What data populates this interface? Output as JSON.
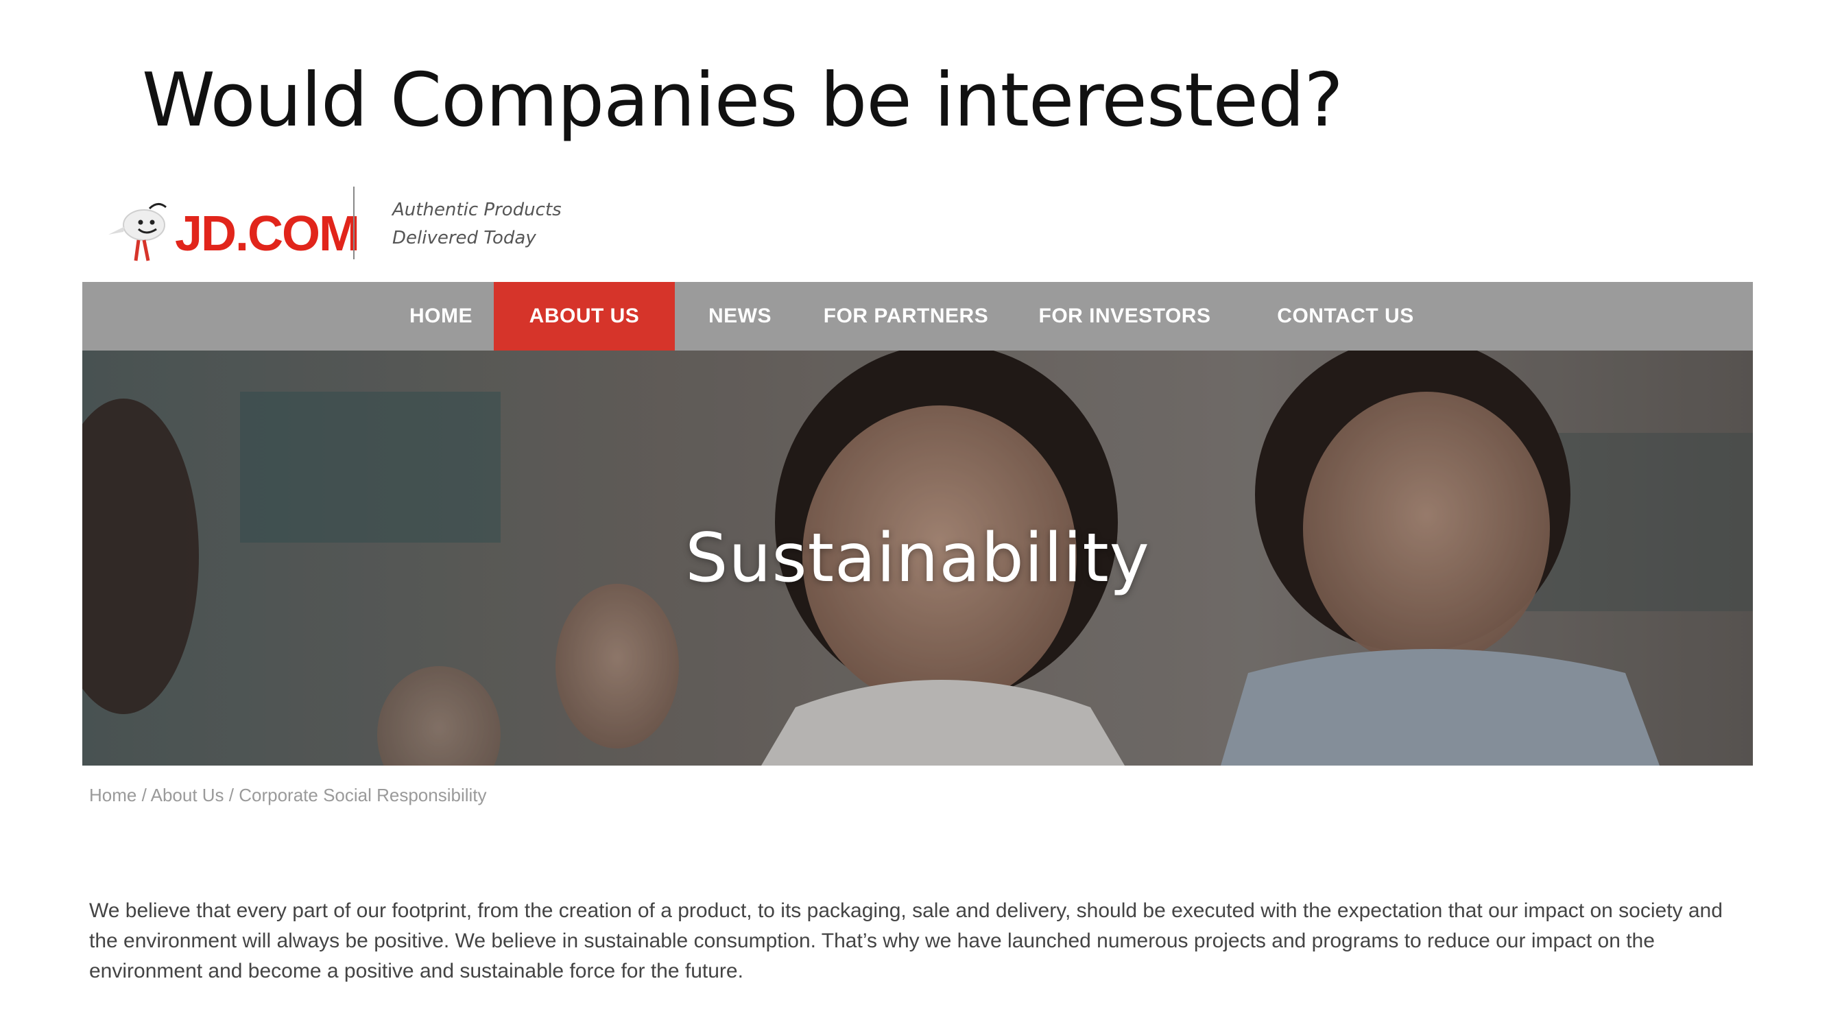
{
  "slide": {
    "title": "Would Companies be interested?"
  },
  "header": {
    "logo_text": "JD.COM",
    "tagline_line1": "Authentic Products",
    "tagline_line2": "Delivered Today",
    "brand_color": "#e1251b"
  },
  "nav": {
    "items": [
      {
        "label": "HOME"
      },
      {
        "label": "ABOUT US",
        "active": true
      },
      {
        "label": "NEWS"
      },
      {
        "label": "FOR PARTNERS"
      },
      {
        "label": "FOR INVESTORS"
      },
      {
        "label": "CONTACT US"
      }
    ],
    "bar_color": "#9b9b9b",
    "active_color": "#d6342a"
  },
  "hero": {
    "title": "Sustainability"
  },
  "breadcrumb": {
    "items": [
      "Home",
      "About Us",
      "Corporate Social Responsibility"
    ],
    "separator": " / "
  },
  "content": {
    "paragraph": "We believe that every part of our footprint, from the creation of a product, to its packaging, sale and delivery, should be executed with the expectation that our impact on society and the environment will always be positive. We believe in sustainable consumption. That’s why we have launched numerous projects and programs to reduce our impact on the environment and become a positive and sustainable force for the future."
  }
}
